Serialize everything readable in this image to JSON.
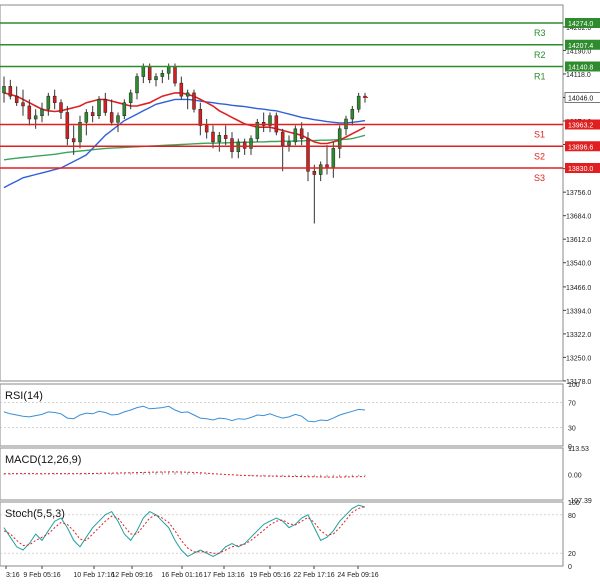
{
  "chart_data": {
    "type": "candlestick",
    "x_tick_labels": [
      "3:16",
      "9 Feb 05:16",
      "10 Feb 17:16",
      "12 Feb 09:16",
      "16 Feb 01:16",
      "17 Feb 13:16",
      "19 Feb 05:16",
      "22 Feb 17:16",
      "24 Feb 09:16"
    ],
    "price_axis_ticks": [
      14262.0,
      14190.0,
      14118.0,
      14046.0,
      13974.0,
      13902.0,
      13828.0,
      13756.0,
      13684.0,
      13612.0,
      13540.0,
      13466.0,
      13394.0,
      13322.0,
      13250.0,
      13178.0
    ],
    "ylim": [
      13178,
      14300
    ],
    "levels": [
      {
        "name": "R3",
        "value": 14274.0,
        "label": "14274.0",
        "color": "#2e8b2e"
      },
      {
        "name": "R2",
        "value": 14207.4,
        "label": "14207.4",
        "color": "#2e8b2e"
      },
      {
        "name": "R1",
        "value": 14140.8,
        "label": "14140.8",
        "color": "#2e8b2e"
      },
      {
        "name": "S1",
        "value": 13963.2,
        "label": "13963.2",
        "color": "#e02020"
      },
      {
        "name": "S2",
        "value": 13896.6,
        "label": "13896.6",
        "color": "#e02020"
      },
      {
        "name": "S3",
        "value": 13830.0,
        "label": "13830.0",
        "color": "#e02020"
      }
    ],
    "current_price": {
      "value": 14046.0,
      "label": "14046.0"
    },
    "candles": [
      {
        "o": 14060,
        "h": 14110,
        "l": 14030,
        "c": 14080
      },
      {
        "o": 14080,
        "h": 14100,
        "l": 14040,
        "c": 14050
      },
      {
        "o": 14050,
        "h": 14080,
        "l": 14020,
        "c": 14030
      },
      {
        "o": 14030,
        "h": 14070,
        "l": 13990,
        "c": 14020
      },
      {
        "o": 14020,
        "h": 14040,
        "l": 13960,
        "c": 13980
      },
      {
        "o": 13980,
        "h": 14010,
        "l": 13950,
        "c": 13990
      },
      {
        "o": 13990,
        "h": 14030,
        "l": 13970,
        "c": 14010
      },
      {
        "o": 14010,
        "h": 14060,
        "l": 13990,
        "c": 14050
      },
      {
        "o": 14050,
        "h": 14070,
        "l": 14010,
        "c": 14030
      },
      {
        "o": 14030,
        "h": 14040,
        "l": 13980,
        "c": 14000
      },
      {
        "o": 14000,
        "h": 14020,
        "l": 13900,
        "c": 13920
      },
      {
        "o": 13920,
        "h": 13960,
        "l": 13870,
        "c": 13910
      },
      {
        "o": 13910,
        "h": 13990,
        "l": 13890,
        "c": 13970
      },
      {
        "o": 13970,
        "h": 14010,
        "l": 13930,
        "c": 14000
      },
      {
        "o": 14000,
        "h": 14020,
        "l": 13970,
        "c": 13990
      },
      {
        "o": 13990,
        "h": 14050,
        "l": 13980,
        "c": 14040
      },
      {
        "o": 14040,
        "h": 14060,
        "l": 13990,
        "c": 14000
      },
      {
        "o": 14000,
        "h": 14040,
        "l": 13960,
        "c": 13970
      },
      {
        "o": 13970,
        "h": 14000,
        "l": 13940,
        "c": 13990
      },
      {
        "o": 13990,
        "h": 14040,
        "l": 13980,
        "c": 14030
      },
      {
        "o": 14030,
        "h": 14070,
        "l": 14010,
        "c": 14060
      },
      {
        "o": 14060,
        "h": 14120,
        "l": 14040,
        "c": 14110
      },
      {
        "o": 14110,
        "h": 14150,
        "l": 14090,
        "c": 14140
      },
      {
        "o": 14140,
        "h": 14150,
        "l": 14090,
        "c": 14100
      },
      {
        "o": 14100,
        "h": 14120,
        "l": 14080,
        "c": 14110
      },
      {
        "o": 14110,
        "h": 14130,
        "l": 14090,
        "c": 14120
      },
      {
        "o": 14120,
        "h": 14150,
        "l": 14100,
        "c": 14140
      },
      {
        "o": 14140,
        "h": 14150,
        "l": 14080,
        "c": 14090
      },
      {
        "o": 14090,
        "h": 14110,
        "l": 14040,
        "c": 14050
      },
      {
        "o": 14050,
        "h": 14070,
        "l": 14010,
        "c": 14060
      },
      {
        "o": 14060,
        "h": 14070,
        "l": 14000,
        "c": 14010
      },
      {
        "o": 14010,
        "h": 14030,
        "l": 13930,
        "c": 13960
      },
      {
        "o": 13960,
        "h": 13980,
        "l": 13920,
        "c": 13940
      },
      {
        "o": 13940,
        "h": 13960,
        "l": 13890,
        "c": 13910
      },
      {
        "o": 13910,
        "h": 13940,
        "l": 13880,
        "c": 13930
      },
      {
        "o": 13930,
        "h": 13960,
        "l": 13900,
        "c": 13920
      },
      {
        "o": 13920,
        "h": 13940,
        "l": 13860,
        "c": 13880
      },
      {
        "o": 13880,
        "h": 13920,
        "l": 13860,
        "c": 13910
      },
      {
        "o": 13910,
        "h": 13920,
        "l": 13870,
        "c": 13890
      },
      {
        "o": 13890,
        "h": 13930,
        "l": 13870,
        "c": 13920
      },
      {
        "o": 13920,
        "h": 13980,
        "l": 13910,
        "c": 13970
      },
      {
        "o": 13970,
        "h": 14000,
        "l": 13940,
        "c": 13960
      },
      {
        "o": 13960,
        "h": 14000,
        "l": 13940,
        "c": 13990
      },
      {
        "o": 13990,
        "h": 14000,
        "l": 13930,
        "c": 13940
      },
      {
        "o": 13940,
        "h": 13950,
        "l": 13820,
        "c": 13900
      },
      {
        "o": 13900,
        "h": 13930,
        "l": 13880,
        "c": 13910
      },
      {
        "o": 13910,
        "h": 13960,
        "l": 13900,
        "c": 13950
      },
      {
        "o": 13950,
        "h": 13970,
        "l": 13900,
        "c": 13920
      },
      {
        "o": 13920,
        "h": 13940,
        "l": 13790,
        "c": 13820
      },
      {
        "o": 13820,
        "h": 13840,
        "l": 13660,
        "c": 13810
      },
      {
        "o": 13810,
        "h": 13850,
        "l": 13790,
        "c": 13840
      },
      {
        "o": 13840,
        "h": 13900,
        "l": 13810,
        "c": 13830
      },
      {
        "o": 13830,
        "h": 13910,
        "l": 13800,
        "c": 13890
      },
      {
        "o": 13890,
        "h": 13960,
        "l": 13860,
        "c": 13950
      },
      {
        "o": 13950,
        "h": 13990,
        "l": 13930,
        "c": 13980
      },
      {
        "o": 13980,
        "h": 14020,
        "l": 13960,
        "c": 14010
      },
      {
        "o": 14010,
        "h": 14060,
        "l": 14000,
        "c": 14050
      },
      {
        "o": 14050,
        "h": 14060,
        "l": 14030,
        "c": 14046
      }
    ],
    "ma_red": [
      14060,
      14055,
      14050,
      14040,
      14030,
      14020,
      14010,
      14005,
      14003,
      14005,
      14010,
      14015,
      14020,
      14030,
      14035,
      14040,
      14040,
      14035,
      14030,
      14025,
      14020,
      14020,
      14025,
      14030,
      14040,
      14050,
      14055,
      14060,
      14060,
      14055,
      14050,
      14040,
      14030,
      14020,
      14005,
      13995,
      13985,
      13975,
      13965,
      13960,
      13955,
      13955,
      13955,
      13950,
      13945,
      13940,
      13935,
      13930,
      13920,
      13910,
      13905,
      13905,
      13910,
      13915,
      13925,
      13935,
      13945,
      13955
    ],
    "ma_blue": [
      13770,
      13780,
      13790,
      13800,
      13805,
      13810,
      13815,
      13820,
      13825,
      13830,
      13840,
      13850,
      13860,
      13870,
      13890,
      13910,
      13930,
      13945,
      13960,
      13975,
      13985,
      13995,
      14005,
      14015,
      14025,
      14030,
      14035,
      14040,
      14040,
      14040,
      14038,
      14035,
      14032,
      14030,
      14027,
      14025,
      14022,
      14020,
      14018,
      14015,
      14012,
      14010,
      14007,
      14005,
      14000,
      13995,
      13990,
      13985,
      13982,
      13978,
      13975,
      13972,
      13970,
      13968,
      13968,
      13970,
      13972,
      13975
    ],
    "ma_green": [
      13855,
      13858,
      13860,
      13862,
      13864,
      13866,
      13868,
      13870,
      13872,
      13875,
      13878,
      13880,
      13882,
      13884,
      13886,
      13888,
      13890,
      13891,
      13892,
      13893,
      13894,
      13895,
      13896,
      13897,
      13898,
      13899,
      13900,
      13901,
      13902,
      13903,
      13904,
      13905,
      13906,
      13906,
      13907,
      13907,
      13908,
      13908,
      13909,
      13909,
      13910,
      13910,
      13911,
      13911,
      13912,
      13912,
      13913,
      13913,
      13914,
      13914,
      13915,
      13915,
      13916,
      13917,
      13918,
      13920,
      13925,
      13930
    ],
    "rsi": {
      "label": "RSI(14)",
      "ticks": [
        100,
        70,
        30,
        0
      ],
      "values": [
        55,
        52,
        50,
        48,
        47,
        49,
        51,
        55,
        54,
        52,
        45,
        44,
        50,
        53,
        52,
        56,
        54,
        50,
        51,
        55,
        58,
        62,
        64,
        60,
        61,
        62,
        64,
        58,
        54,
        55,
        50,
        45,
        44,
        42,
        45,
        44,
        41,
        44,
        43,
        46,
        50,
        49,
        52,
        48,
        45,
        47,
        51,
        48,
        40,
        39,
        42,
        41,
        45,
        50,
        53,
        56,
        59,
        58
      ]
    },
    "macd": {
      "label": "MACD(12,26,9)",
      "ticks": [
        113.53,
        0.0,
        -107.39
      ],
      "histogram": [
        10,
        11,
        12,
        12,
        11,
        10,
        10,
        11,
        12,
        12,
        11,
        10,
        11,
        12,
        13,
        14,
        15,
        16,
        17,
        18,
        20,
        22,
        24,
        26,
        27,
        28,
        28,
        27,
        25,
        22,
        18,
        14,
        10,
        6,
        2,
        -2,
        -5,
        -8,
        -10,
        -12,
        -13,
        -14,
        -14,
        -15,
        -16,
        -17,
        -18,
        -19,
        -20,
        -22,
        -24,
        -25,
        -24,
        -22,
        -20,
        -17,
        -14,
        -12
      ],
      "signal": [
        9,
        10,
        11,
        11,
        11,
        10,
        10,
        10,
        11,
        11,
        11,
        10,
        11,
        11,
        12,
        13,
        14,
        15,
        16,
        17,
        18,
        20,
        22,
        24,
        25,
        26,
        27,
        27,
        26,
        24,
        21,
        18,
        14,
        10,
        6,
        2,
        -1,
        -4,
        -7,
        -9,
        -11,
        -12,
        -13,
        -14,
        -15,
        -16,
        -17,
        -18,
        -19,
        -20,
        -21,
        -22,
        -22,
        -22,
        -21,
        -20,
        -19,
        -18
      ]
    },
    "stoch": {
      "label": "Stoch(5,5,3)",
      "ticks": [
        100,
        80,
        20,
        0
      ],
      "main": [
        60,
        45,
        30,
        25,
        35,
        50,
        40,
        55,
        70,
        75,
        60,
        40,
        30,
        45,
        60,
        70,
        80,
        85,
        70,
        50,
        40,
        55,
        75,
        85,
        80,
        70,
        60,
        40,
        25,
        15,
        20,
        25,
        20,
        15,
        20,
        30,
        35,
        30,
        35,
        45,
        55,
        65,
        70,
        75,
        70,
        60,
        65,
        75,
        80,
        60,
        40,
        45,
        55,
        70,
        80,
        90,
        95,
        92
      ],
      "signal": [
        55,
        50,
        40,
        32,
        33,
        40,
        45,
        50,
        60,
        68,
        65,
        55,
        42,
        40,
        50,
        60,
        70,
        78,
        75,
        62,
        50,
        50,
        62,
        75,
        80,
        75,
        68,
        55,
        40,
        28,
        22,
        22,
        22,
        20,
        20,
        25,
        30,
        32,
        34,
        40,
        48,
        56,
        64,
        70,
        72,
        66,
        64,
        70,
        76,
        68,
        55,
        48,
        50,
        60,
        72,
        84,
        90,
        93
      ]
    }
  }
}
